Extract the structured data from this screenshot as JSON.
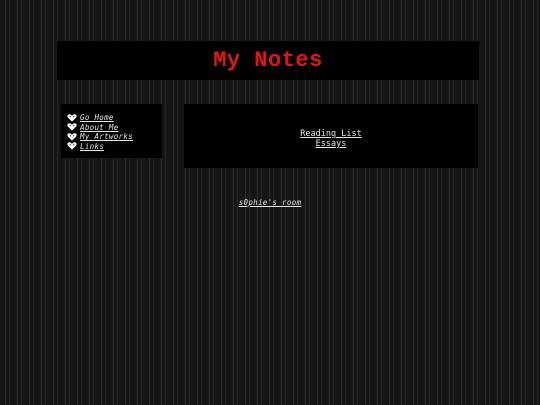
{
  "header": {
    "title": "My Notes"
  },
  "sidebar": {
    "items": [
      {
        "label": "Go Home",
        "icon": "heart-icon"
      },
      {
        "label": "About Me",
        "icon": "heart-icon"
      },
      {
        "label": "My Artworks",
        "icon": "heart-icon"
      },
      {
        "label": "Links",
        "icon": "heart-icon"
      }
    ]
  },
  "main": {
    "links": [
      "Reading List",
      "Essays"
    ]
  },
  "footer": {
    "link_label": "s0phie's room"
  },
  "colors": {
    "title": "#c81f1f",
    "panel": "#000000",
    "text": "#e6e6e6",
    "icon": "#ffffff"
  }
}
